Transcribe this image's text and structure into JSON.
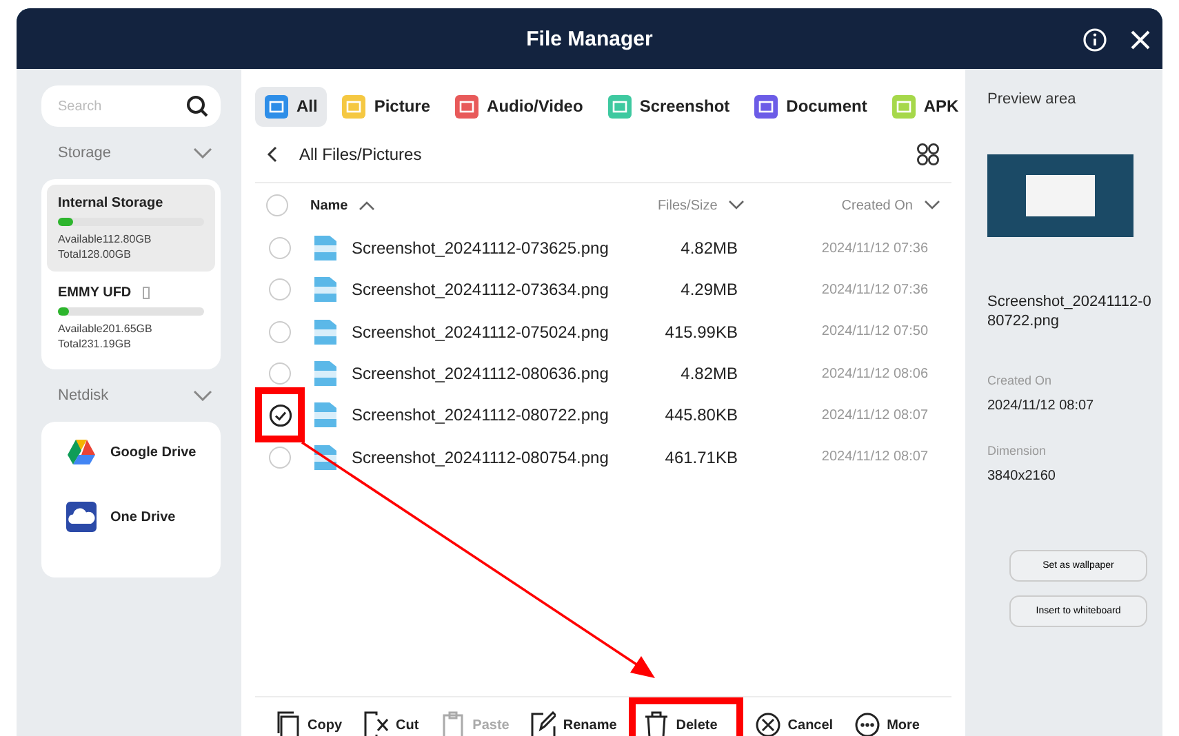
{
  "window": {
    "title": "File Manager"
  },
  "sidebar": {
    "search": {
      "placeholder": "Search"
    },
    "storage_label": "Storage",
    "storage": [
      {
        "name": "Internal Storage",
        "selected": true,
        "removable": false,
        "level": 0.1,
        "available": "Available112.80GB",
        "total": "Total128.00GB"
      },
      {
        "name": "EMMY UFD",
        "selected": false,
        "removable": true,
        "level": 0.08,
        "available": "Available201.65GB",
        "total": "Total231.19GB"
      }
    ],
    "netdisk_label": "Netdisk",
    "netdisks": [
      {
        "kind": "google",
        "name": "Google Drive"
      },
      {
        "kind": "onedrive",
        "name": "One Drive"
      }
    ]
  },
  "tabs": [
    {
      "label": "All",
      "selected": true,
      "color": "#2e8ee8"
    },
    {
      "label": "Picture",
      "selected": false,
      "color": "#f5c842"
    },
    {
      "label": "Audio/Video",
      "selected": false,
      "color": "#e85a5a"
    },
    {
      "label": "Screenshot",
      "selected": false,
      "color": "#3ec9a0"
    },
    {
      "label": "Document",
      "selected": false,
      "color": "#6c5ce7"
    },
    {
      "label": "APK",
      "selected": false,
      "color": "#a6d84a"
    }
  ],
  "breadcrumb": "All Files/Pictures",
  "table": {
    "columns": [
      "Name",
      "Files/Size",
      "Created On"
    ],
    "all_selected": false,
    "rows": [
      {
        "name": "Screenshot_20241112-073625.png",
        "size": "4.82MB",
        "date": "2024/11/12 07:36",
        "selected": false,
        "annotated": false
      },
      {
        "name": "Screenshot_20241112-073634.png",
        "size": "4.29MB",
        "date": "2024/11/12 07:36",
        "selected": false,
        "annotated": false
      },
      {
        "name": "Screenshot_20241112-075024.png",
        "size": "415.99KB",
        "date": "2024/11/12 07:50",
        "selected": false,
        "annotated": false
      },
      {
        "name": "Screenshot_20241112-080636.png",
        "size": "4.82MB",
        "date": "2024/11/12 08:06",
        "selected": false,
        "annotated": false
      },
      {
        "name": "Screenshot_20241112-080722.png",
        "size": "445.80KB",
        "date": "2024/11/12 08:07",
        "selected": true,
        "annotated": true
      },
      {
        "name": "Screenshot_20241112-080754.png",
        "size": "461.71KB",
        "date": "2024/11/12 08:07",
        "selected": false,
        "annotated": false
      }
    ]
  },
  "toolbar": [
    {
      "kind": "copy",
      "label": "Copy",
      "disabled": false,
      "annotated": false
    },
    {
      "kind": "cut",
      "label": "Cut",
      "disabled": false,
      "annotated": false
    },
    {
      "kind": "paste",
      "label": "Paste",
      "disabled": true,
      "annotated": false
    },
    {
      "kind": "rename",
      "label": "Rename",
      "disabled": false,
      "annotated": false
    },
    {
      "kind": "delete",
      "label": "Delete",
      "disabled": false,
      "annotated": true
    },
    {
      "kind": "cancel",
      "label": "Cancel",
      "disabled": false,
      "annotated": false
    },
    {
      "kind": "more",
      "label": "More",
      "disabled": false,
      "annotated": false
    }
  ],
  "preview": {
    "title": "Preview area",
    "filename": "Screenshot_20241112-0\n80722.png",
    "fields": [
      {
        "label": "Created On",
        "value": "2024/11/12 08:07"
      },
      {
        "label": "Dimension",
        "value": "3840x2160"
      }
    ],
    "buttons": [
      "Set as wallpaper",
      "Insert to whiteboard"
    ]
  }
}
